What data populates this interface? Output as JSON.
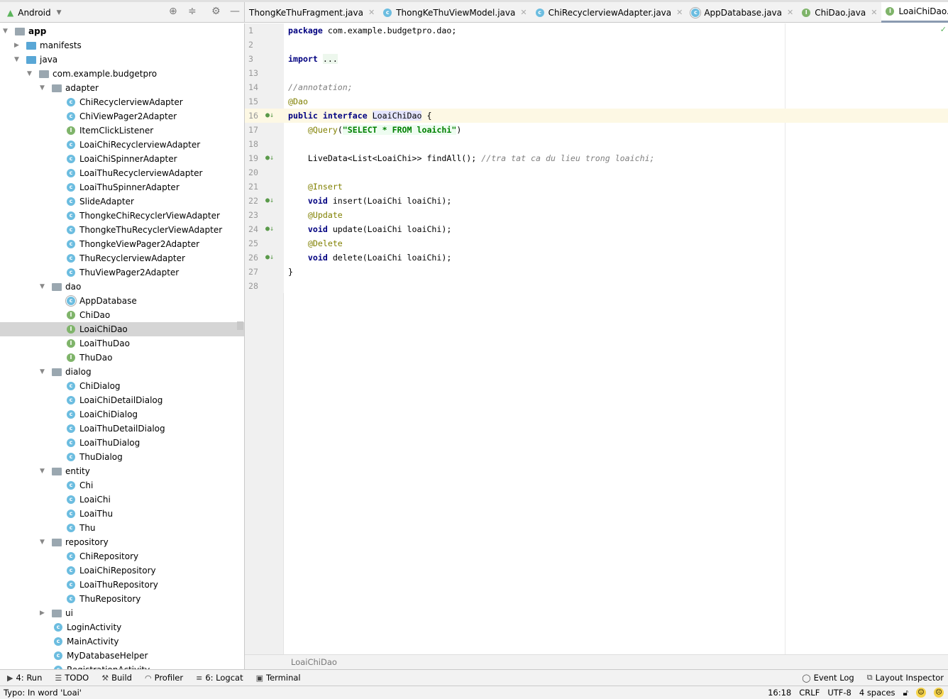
{
  "project": {
    "view": "Android"
  },
  "tabs": [
    {
      "label": "ThongKeThuFragment.java",
      "icon": "none",
      "active": false
    },
    {
      "label": "ThongKeThuViewModel.java",
      "icon": "c",
      "active": false
    },
    {
      "label": "ChiRecyclerviewAdapter.java",
      "icon": "c",
      "active": false
    },
    {
      "label": "AppDatabase.java",
      "icon": "a",
      "active": false
    },
    {
      "label": "ChiDao.java",
      "icon": "i",
      "active": false
    },
    {
      "label": "LoaiChiDao.java",
      "icon": "i",
      "active": true
    }
  ],
  "tree": [
    {
      "label": "app",
      "depth": 0,
      "type": "module",
      "expanded": true
    },
    {
      "label": "manifests",
      "depth": 1,
      "type": "folder-blue",
      "expanded": false
    },
    {
      "label": "java",
      "depth": 1,
      "type": "folder-blue",
      "expanded": true
    },
    {
      "label": "com.example.budgetpro",
      "depth": 2,
      "type": "folder",
      "expanded": true
    },
    {
      "label": "adapter",
      "depth": 3,
      "type": "folder",
      "expanded": true
    },
    {
      "label": "ChiRecyclerviewAdapter",
      "depth": 4,
      "type": "c"
    },
    {
      "label": "ChiViewPager2Adapter",
      "depth": 4,
      "type": "c"
    },
    {
      "label": "ItemClickListener",
      "depth": 4,
      "type": "i"
    },
    {
      "label": "LoaiChiRecyclerviewAdapter",
      "depth": 4,
      "type": "c"
    },
    {
      "label": "LoaiChiSpinnerAdapter",
      "depth": 4,
      "type": "c"
    },
    {
      "label": "LoaiThuRecyclerviewAdapter",
      "depth": 4,
      "type": "c"
    },
    {
      "label": "LoaiThuSpinnerAdapter",
      "depth": 4,
      "type": "c"
    },
    {
      "label": "SlideAdapter",
      "depth": 4,
      "type": "c"
    },
    {
      "label": "ThongkeChiRecyclerViewAdapter",
      "depth": 4,
      "type": "c"
    },
    {
      "label": "ThongkeThuRecyclerViewAdapter",
      "depth": 4,
      "type": "c"
    },
    {
      "label": "ThongkeViewPager2Adapter",
      "depth": 4,
      "type": "c"
    },
    {
      "label": "ThuRecyclerviewAdapter",
      "depth": 4,
      "type": "c"
    },
    {
      "label": "ThuViewPager2Adapter",
      "depth": 4,
      "type": "c"
    },
    {
      "label": "dao",
      "depth": 3,
      "type": "folder",
      "expanded": true
    },
    {
      "label": "AppDatabase",
      "depth": 4,
      "type": "a"
    },
    {
      "label": "ChiDao",
      "depth": 4,
      "type": "i"
    },
    {
      "label": "LoaiChiDao",
      "depth": 4,
      "type": "i",
      "selected": true
    },
    {
      "label": "LoaiThuDao",
      "depth": 4,
      "type": "i"
    },
    {
      "label": "ThuDao",
      "depth": 4,
      "type": "i"
    },
    {
      "label": "dialog",
      "depth": 3,
      "type": "folder",
      "expanded": true
    },
    {
      "label": "ChiDialog",
      "depth": 4,
      "type": "c"
    },
    {
      "label": "LoaiChiDetailDialog",
      "depth": 4,
      "type": "c"
    },
    {
      "label": "LoaiChiDialog",
      "depth": 4,
      "type": "c"
    },
    {
      "label": "LoaiThuDetailDialog",
      "depth": 4,
      "type": "c"
    },
    {
      "label": "LoaiThuDialog",
      "depth": 4,
      "type": "c"
    },
    {
      "label": "ThuDialog",
      "depth": 4,
      "type": "c"
    },
    {
      "label": "entity",
      "depth": 3,
      "type": "folder",
      "expanded": true
    },
    {
      "label": "Chi",
      "depth": 4,
      "type": "c"
    },
    {
      "label": "LoaiChi",
      "depth": 4,
      "type": "c"
    },
    {
      "label": "LoaiThu",
      "depth": 4,
      "type": "c"
    },
    {
      "label": "Thu",
      "depth": 4,
      "type": "c"
    },
    {
      "label": "repository",
      "depth": 3,
      "type": "folder",
      "expanded": true
    },
    {
      "label": "ChiRepository",
      "depth": 4,
      "type": "c"
    },
    {
      "label": "LoaiChiRepository",
      "depth": 4,
      "type": "c"
    },
    {
      "label": "LoaiThuRepository",
      "depth": 4,
      "type": "c"
    },
    {
      "label": "ThuRepository",
      "depth": 4,
      "type": "c"
    },
    {
      "label": "ui",
      "depth": 3,
      "type": "folder",
      "expanded": false
    },
    {
      "label": "LoginActivity",
      "depth": 3,
      "type": "c"
    },
    {
      "label": "MainActivity",
      "depth": 3,
      "type": "c"
    },
    {
      "label": "MyDatabaseHelper",
      "depth": 3,
      "type": "c"
    },
    {
      "label": "RegistrationActivity",
      "depth": 3,
      "type": "c"
    }
  ],
  "code": [
    {
      "num": "1",
      "segs": [
        [
          "package",
          "kw"
        ],
        [
          " com.example.budgetpro.dao;",
          ""
        ]
      ]
    },
    {
      "num": "2",
      "segs": []
    },
    {
      "num": "3",
      "segs": [
        [
          "import",
          "kw"
        ],
        [
          " ",
          ""
        ],
        [
          "...",
          "fold"
        ]
      ]
    },
    {
      "num": "13",
      "segs": []
    },
    {
      "num": "14",
      "segs": [
        [
          "//annotation;",
          "cm"
        ]
      ]
    },
    {
      "num": "15",
      "segs": [
        [
          "@Dao",
          "an"
        ]
      ]
    },
    {
      "num": "16",
      "marker": true,
      "current": true,
      "segs": [
        [
          "public interface ",
          "kw"
        ],
        [
          "LoaiChiDao",
          "hl"
        ],
        [
          " {",
          ""
        ]
      ]
    },
    {
      "num": "17",
      "segs": [
        [
          "    ",
          ""
        ],
        [
          "@Query",
          "an"
        ],
        [
          "(",
          ""
        ],
        [
          "\"SELECT * FROM loaichi\"",
          "st"
        ],
        [
          ")",
          ""
        ]
      ]
    },
    {
      "num": "18",
      "segs": []
    },
    {
      "num": "19",
      "marker": true,
      "segs": [
        [
          "    LiveData<List<LoaiChi>> findAll(); ",
          ""
        ],
        [
          "//tra tat ca du lieu trong loaichi;",
          "cm"
        ]
      ]
    },
    {
      "num": "20",
      "segs": []
    },
    {
      "num": "21",
      "segs": [
        [
          "    ",
          ""
        ],
        [
          "@Insert",
          "an"
        ]
      ]
    },
    {
      "num": "22",
      "marker": true,
      "segs": [
        [
          "    ",
          ""
        ],
        [
          "void",
          "kw"
        ],
        [
          " insert(LoaiChi loaiChi);",
          ""
        ]
      ]
    },
    {
      "num": "23",
      "segs": [
        [
          "    ",
          ""
        ],
        [
          "@Update",
          "an"
        ]
      ]
    },
    {
      "num": "24",
      "marker": true,
      "segs": [
        [
          "    ",
          ""
        ],
        [
          "void",
          "kw"
        ],
        [
          " update(LoaiChi loaiChi);",
          ""
        ]
      ]
    },
    {
      "num": "25",
      "segs": [
        [
          "    ",
          ""
        ],
        [
          "@Delete",
          "an"
        ]
      ]
    },
    {
      "num": "26",
      "marker": true,
      "segs": [
        [
          "    ",
          ""
        ],
        [
          "void",
          "kw"
        ],
        [
          " delete(LoaiChi loaiChi);",
          ""
        ]
      ]
    },
    {
      "num": "27",
      "segs": [
        [
          "}",
          ""
        ]
      ]
    },
    {
      "num": "28",
      "segs": []
    }
  ],
  "breadcrumb": "LoaiChiDao",
  "toolwindows": {
    "run": "4: Run",
    "todo": "TODO",
    "build": "Build",
    "profiler": "Profiler",
    "logcat": "6: Logcat",
    "terminal": "Terminal",
    "event_log": "Event Log",
    "layout_inspector": "Layout Inspector"
  },
  "status": {
    "message": "Typo: In word 'Loai'",
    "position": "16:18",
    "line_sep": "CRLF",
    "encoding": "UTF-8",
    "indent": "4 spaces"
  }
}
